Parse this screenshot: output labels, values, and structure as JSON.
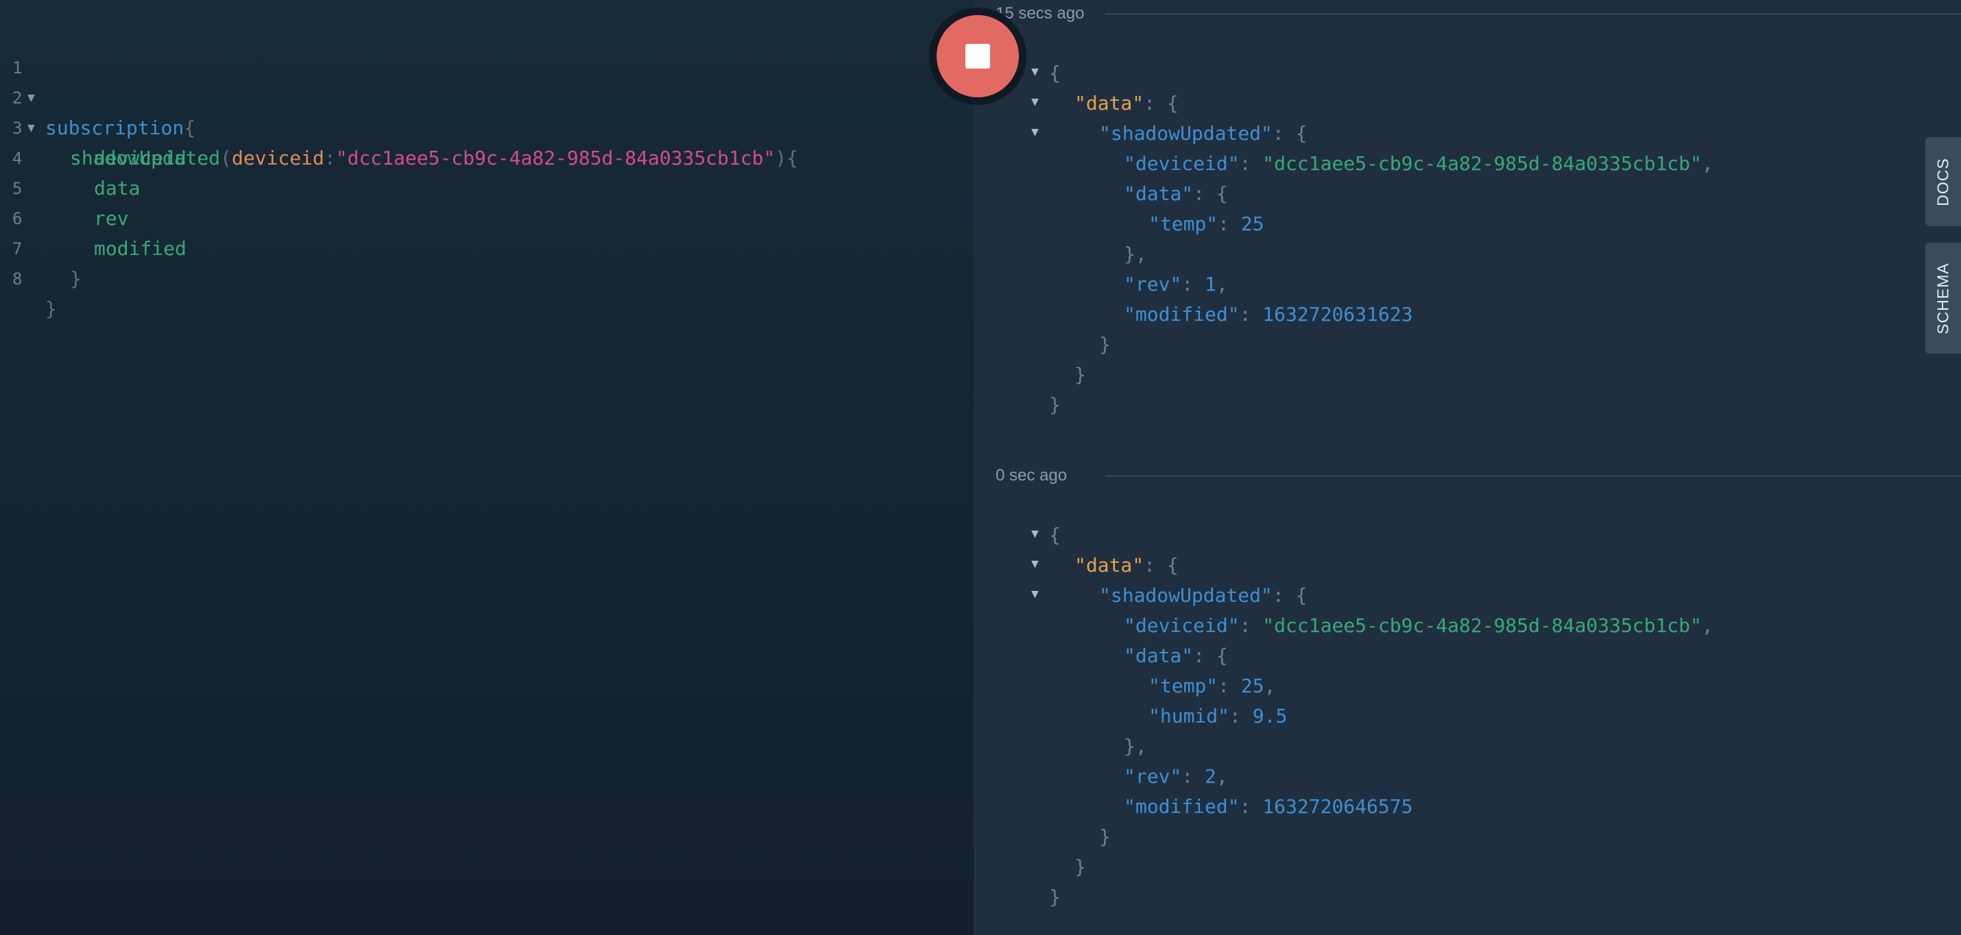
{
  "editor": {
    "line_numbers": [
      "1",
      "2",
      "3",
      "4",
      "5",
      "6",
      "7",
      "8"
    ],
    "keyword": "subscription",
    "open_brace": "{",
    "close_brace": "}",
    "operation": "shadowUpdated",
    "arg_name": "deviceid",
    "arg_value": "\"dcc1aee5-cb9c-4a82-985d-84a0335cb1cb\"",
    "fields": [
      "deviceid",
      "data",
      "rev",
      "modified"
    ]
  },
  "results": [
    {
      "time_label": "15 secs ago",
      "deviceid": "\"dcc1aee5-cb9c-4a82-985d-84a0335cb1cb\"",
      "temp": "25",
      "humid": null,
      "rev": "1",
      "modified": "1632720631623"
    },
    {
      "time_label": "0 sec ago",
      "deviceid": "\"dcc1aee5-cb9c-4a82-985d-84a0335cb1cb\"",
      "temp": "25",
      "humid": "9.5",
      "rev": "2",
      "modified": "1632720646575"
    }
  ],
  "json_keys": {
    "data": "\"data\"",
    "shadowUpdated": "\"shadowUpdated\"",
    "deviceid": "\"deviceid\"",
    "temp": "\"temp\"",
    "humid": "\"humid\"",
    "rev": "\"rev\"",
    "modified": "\"modified\""
  },
  "side_tabs": {
    "docs": "DOCS",
    "schema": "SCHEMA"
  },
  "colors": {
    "stop_button": "#e26a63",
    "editor_bg": "#172a38",
    "results_bg": "#1f2f40"
  },
  "icons": {
    "stop": "stop-square-icon",
    "fold": "fold-arrow-icon"
  }
}
